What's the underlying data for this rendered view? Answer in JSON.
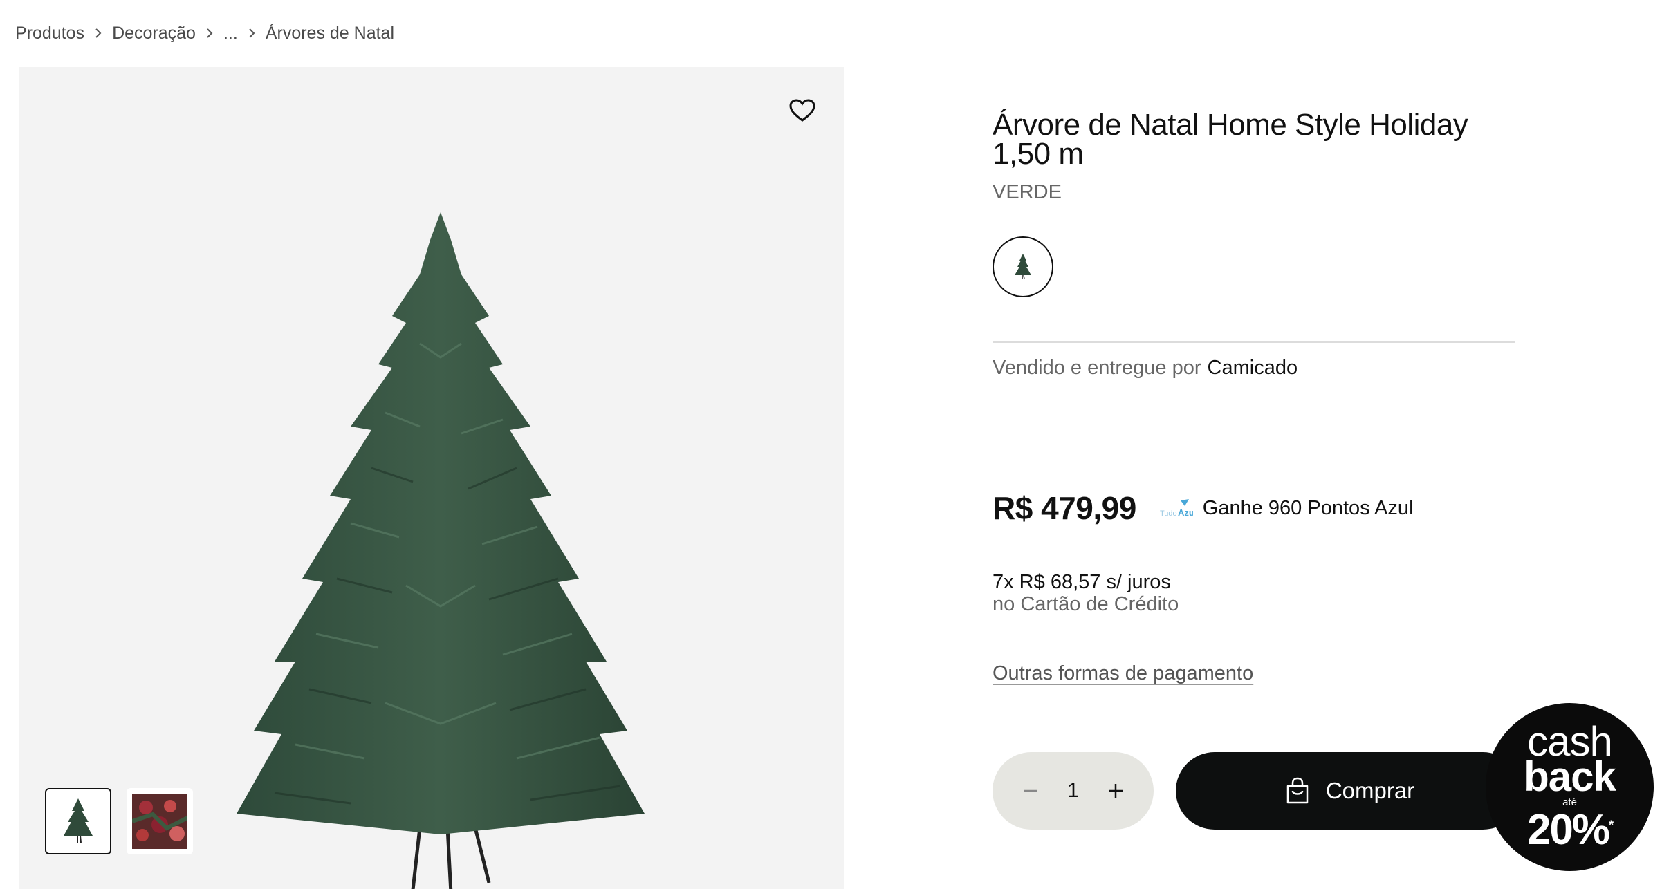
{
  "breadcrumb": {
    "items": [
      "Produtos",
      "Decoração",
      "...",
      "Árvores de Natal"
    ]
  },
  "product": {
    "title": "Árvore de Natal Home Style Holiday 1,50 m",
    "color": "VERDE",
    "seller_prefix": "Vendido e entregue por",
    "seller_name": "Camicado",
    "price": "R$ 479,99",
    "points_text": "Ganhe 960 Pontos Azul",
    "installments": "7x R$ 68,57 s/ juros",
    "installments_method": "no Cartão de Crédito",
    "other_payments": "Outras formas de pagamento",
    "quantity": "1",
    "buy_label": "Comprar"
  },
  "icons": {
    "favorite": "heart-icon",
    "chevron": "chevron-right-icon",
    "minus": "minus-icon",
    "plus": "plus-icon",
    "bag": "shopping-bag-icon"
  },
  "cashback": {
    "line1": "cash",
    "line2": "back",
    "prefix": "até",
    "percent": "20%",
    "asterisk": "*"
  },
  "colors": {
    "buy_button": "#0d0f0f",
    "quantity_bg": "#e6e6e1",
    "gallery_bg": "#f3f3f3",
    "points_blue": "#4aa8d8"
  }
}
